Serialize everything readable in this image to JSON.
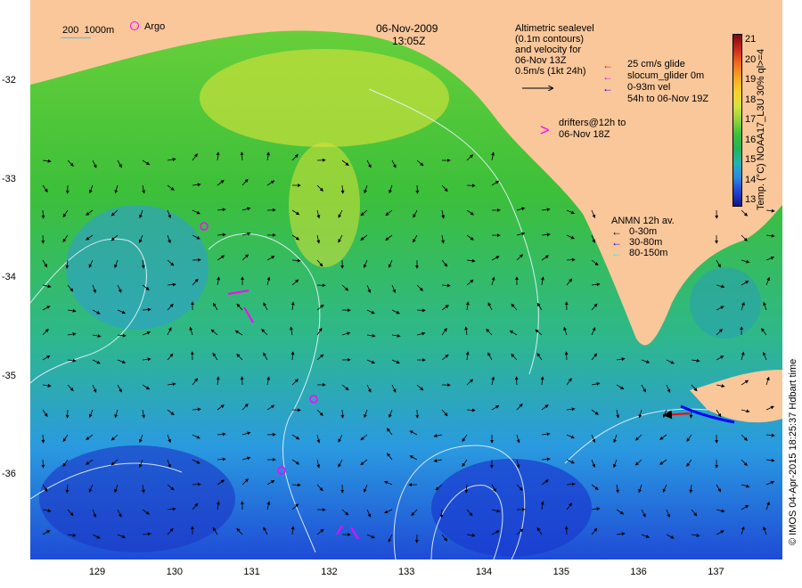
{
  "date": "06-Nov-2009",
  "time": "13:05Z",
  "bathymetry_legend": {
    "a": "200",
    "b": "1000m"
  },
  "argo_label": "Argo",
  "altimetry_note": [
    "Altimetric sealevel",
    "(0.1m contours)",
    "and velocity for",
    "06-Nov 13Z",
    "0.5m/s (1kt 24h)"
  ],
  "glider_legend": {
    "glide_25": "25 cm/s glide",
    "slocum": "slocum_glider 0m",
    "vel": "0-93m vel",
    "vel_time": "54h to 06-Nov 19Z"
  },
  "drifters": [
    "drifters@12h to",
    "06-Nov 18Z"
  ],
  "anmn": {
    "title": "ANMN 12h av.",
    "items": [
      {
        "label": "0-30m",
        "color": "#000000"
      },
      {
        "label": "30-80m",
        "color": "#0000ff"
      },
      {
        "label": "80-150m",
        "color": "#00ffff"
      }
    ]
  },
  "colorbar": {
    "title": "Temp. (°C) NOAA17_L3U 30% ql>=4",
    "labels": [
      "21",
      "20",
      "19",
      "18",
      "17",
      "16",
      "15",
      "14",
      "13"
    ],
    "colors": [
      "#7a0a0a",
      "#c8281e",
      "#f06a1e",
      "#f5a623",
      "#f7d12a",
      "#d6e43a",
      "#8fd43a",
      "#3dbf3a",
      "#22b35a",
      "#22b4b4",
      "#2a8ae0",
      "#2244d0",
      "#10148a"
    ]
  },
  "credit": "© IMOS 04-Apr-2015 18:25:37 Hdbart time",
  "x_ticks": [
    "129",
    "130",
    "131",
    "132",
    "133",
    "134",
    "135",
    "136",
    "137"
  ],
  "y_ticks": [
    "-32",
    "-33",
    "-34",
    "-35",
    "-36"
  ],
  "colors": {
    "land": "#f9c79a",
    "arrow": "#000000",
    "contour": "#e8f4ff",
    "glider": "#ff00ff",
    "red_arrow": "#ff0000"
  }
}
